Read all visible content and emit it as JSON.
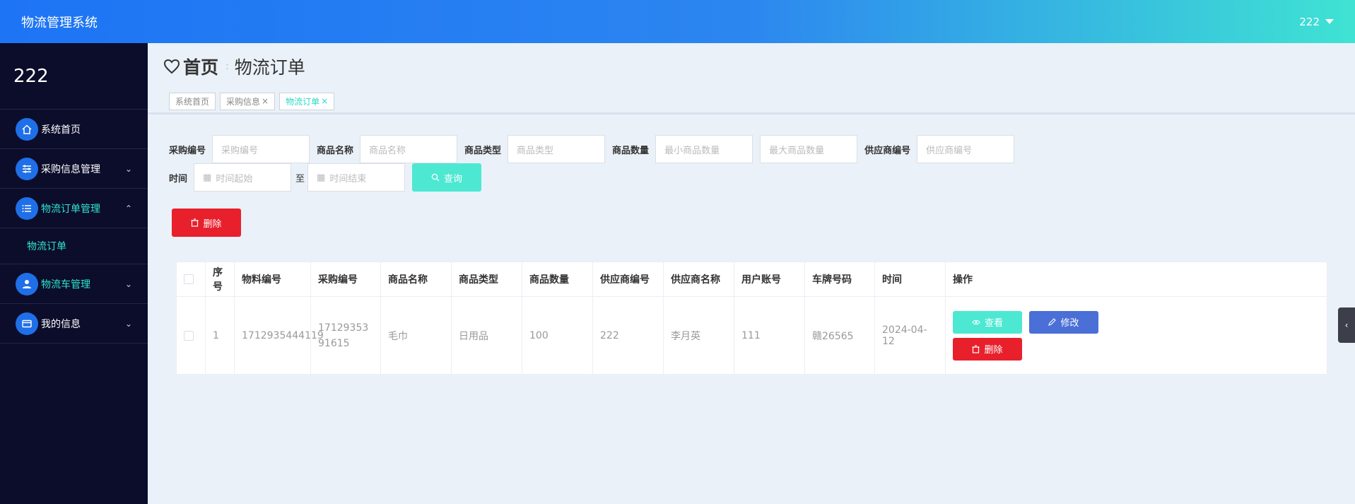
{
  "header": {
    "title": "物流管理系统",
    "user": "222"
  },
  "sidebar": {
    "head": "222",
    "items": [
      {
        "label": "系统首页",
        "icon": "home-icon",
        "expanded": null
      },
      {
        "label": "采购信息管理",
        "icon": "sliders-icon",
        "expanded": false
      },
      {
        "label": "物流订单管理",
        "icon": "list-icon",
        "expanded": true,
        "children": [
          {
            "label": "物流订单"
          }
        ]
      },
      {
        "label": "物流车管理",
        "icon": "user-icon",
        "expanded": false
      },
      {
        "label": "我的信息",
        "icon": "card-icon",
        "expanded": false
      }
    ]
  },
  "breadcrumb": {
    "home": "首页",
    "separator": ":",
    "current": "物流订单"
  },
  "tabs": [
    {
      "label": "系统首页",
      "closable": false,
      "active": false
    },
    {
      "label": "采购信息",
      "closable": true,
      "active": false
    },
    {
      "label": "物流订单",
      "closable": true,
      "active": true
    }
  ],
  "search": {
    "purchase_no_label": "采购编号",
    "purchase_no_placeholder": "采购编号",
    "product_name_label": "商品名称",
    "product_name_placeholder": "商品名称",
    "product_type_label": "商品类型",
    "product_type_placeholder": "商品类型",
    "quantity_label": "商品数量",
    "quantity_min_placeholder": "最小商品数量",
    "quantity_max_placeholder": "最大商品数量",
    "supplier_no_label": "供应商编号",
    "supplier_no_placeholder": "供应商编号",
    "time_label": "时间",
    "time_start_placeholder": "时间起始",
    "time_to": "至",
    "time_end_placeholder": "时间结束",
    "query_label": "查询"
  },
  "toolbar": {
    "delete_label": "删除"
  },
  "table": {
    "columns": [
      "序号",
      "物料编号",
      "采购编号",
      "商品名称",
      "商品类型",
      "商品数量",
      "供应商编号",
      "供应商名称",
      "用户账号",
      "车牌号码",
      "时间",
      "操作"
    ],
    "rows": [
      {
        "index": "1",
        "material_no": "1712935444119",
        "purchase_no": "1712935391615",
        "product_name": "毛巾",
        "product_type": "日用品",
        "quantity": "100",
        "supplier_no": "222",
        "supplier_name": "李月英",
        "account": "111",
        "plate": "赣26565",
        "time": "2024-04-12"
      }
    ],
    "actions": {
      "view": "查看",
      "edit": "修改",
      "delete": "删除"
    }
  },
  "colors": {
    "accent": "#4de8d2",
    "primary": "#1d74f5",
    "danger": "#e8202c",
    "edit": "#4a6fd6",
    "sidebar_bg": "#0c0d2b"
  }
}
